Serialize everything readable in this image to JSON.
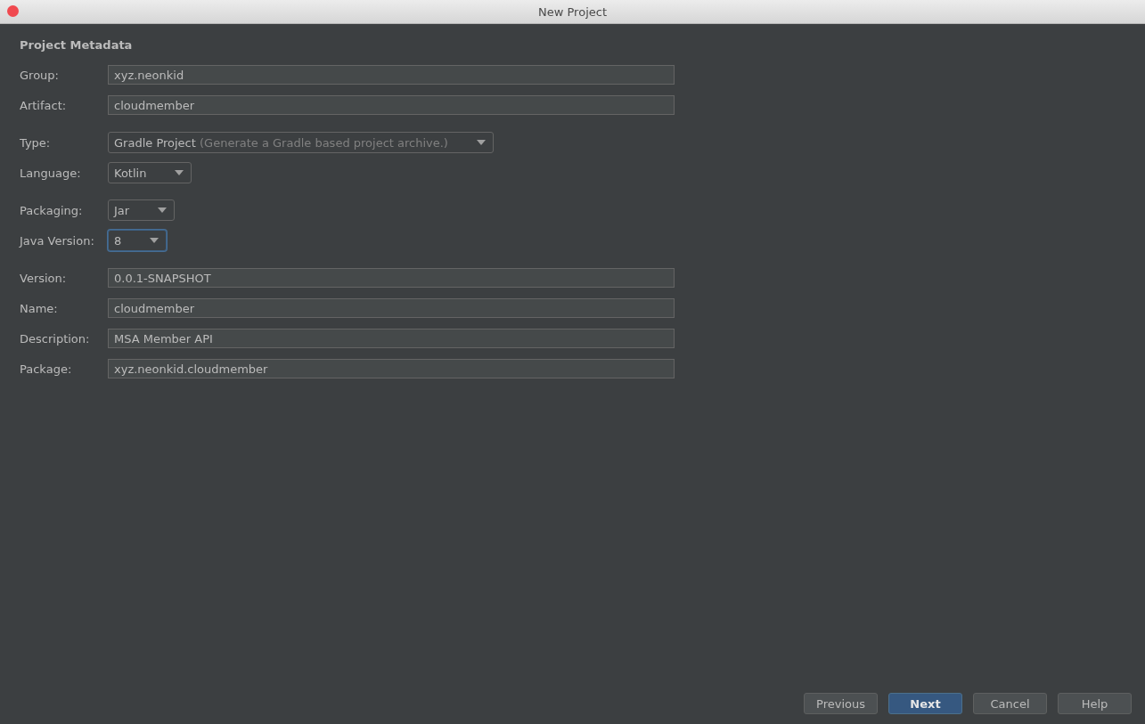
{
  "window": {
    "title": "New Project"
  },
  "heading": "Project Metadata",
  "sections": [
    {
      "fields": [
        {
          "kind": "text",
          "label": "Group:",
          "value": "xyz.neonkid",
          "focused": false
        },
        {
          "kind": "text",
          "label": "Artifact:",
          "value": "cloudmember",
          "focused": false
        }
      ]
    },
    {
      "fields": [
        {
          "kind": "dropdown",
          "label": "Type:",
          "value": "Gradle Project",
          "hint": "(Generate a Gradle based project archive.)",
          "focused": false
        },
        {
          "kind": "dropdown",
          "label": "Language:",
          "value": "Kotlin",
          "focused": false
        }
      ]
    },
    {
      "fields": [
        {
          "kind": "dropdown",
          "label": "Packaging:",
          "value": "Jar",
          "focused": false
        },
        {
          "kind": "dropdown",
          "label": "Java Version:",
          "value": "8",
          "focused": true
        }
      ]
    },
    {
      "fields": [
        {
          "kind": "text",
          "label": "Version:",
          "value": "0.0.1-SNAPSHOT",
          "focused": false
        },
        {
          "kind": "text",
          "label": "Name:",
          "value": "cloudmember",
          "focused": false
        },
        {
          "kind": "text",
          "label": "Description:",
          "value": "MSA Member API",
          "focused": false
        },
        {
          "kind": "text",
          "label": "Package:",
          "value": "xyz.neonkid.cloudmember",
          "focused": false
        }
      ]
    }
  ],
  "buttons": [
    {
      "label": "Previous",
      "default": false
    },
    {
      "label": "Next",
      "default": true
    },
    {
      "label": "Cancel",
      "default": false
    },
    {
      "label": "Help",
      "default": false
    }
  ]
}
